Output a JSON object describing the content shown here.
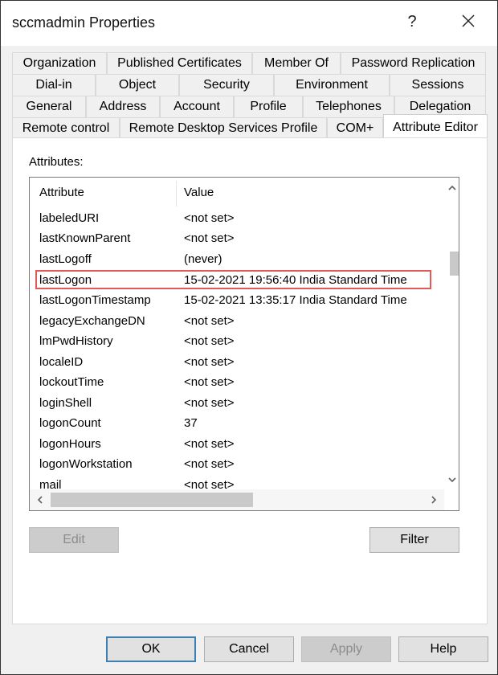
{
  "window": {
    "title": "sccmadmin Properties",
    "help_label": "?"
  },
  "tabs": {
    "row1": [
      "Organization",
      "Published Certificates",
      "Member Of",
      "Password Replication"
    ],
    "row2": [
      "Dial-in",
      "Object",
      "Security",
      "Environment",
      "Sessions"
    ],
    "row3": [
      "General",
      "Address",
      "Account",
      "Profile",
      "Telephones",
      "Delegation"
    ],
    "row4": [
      "Remote control",
      "Remote Desktop Services Profile",
      "COM+",
      "Attribute Editor"
    ],
    "active": "Attribute Editor"
  },
  "attributes": {
    "label": "Attributes:",
    "columns": {
      "attribute": "Attribute",
      "value": "Value"
    },
    "rows": [
      {
        "attribute": "labeledURI",
        "value": "<not set>"
      },
      {
        "attribute": "lastKnownParent",
        "value": "<not set>"
      },
      {
        "attribute": "lastLogoff",
        "value": "(never)"
      },
      {
        "attribute": "lastLogon",
        "value": "15-02-2021 19:56:40 India Standard Time"
      },
      {
        "attribute": "lastLogonTimestamp",
        "value": "15-02-2021 13:35:17 India Standard Time"
      },
      {
        "attribute": "legacyExchangeDN",
        "value": "<not set>"
      },
      {
        "attribute": "lmPwdHistory",
        "value": "<not set>"
      },
      {
        "attribute": "localeID",
        "value": "<not set>"
      },
      {
        "attribute": "lockoutTime",
        "value": "<not set>"
      },
      {
        "attribute": "loginShell",
        "value": "<not set>"
      },
      {
        "attribute": "logonCount",
        "value": "37"
      },
      {
        "attribute": "logonHours",
        "value": "<not set>"
      },
      {
        "attribute": "logonWorkstation",
        "value": "<not set>"
      },
      {
        "attribute": "mail",
        "value": "<not set>"
      }
    ],
    "highlighted_row": "lastLogon"
  },
  "panel_buttons": {
    "edit": "Edit",
    "filter": "Filter"
  },
  "footer_buttons": {
    "ok": "OK",
    "cancel": "Cancel",
    "apply": "Apply",
    "help": "Help"
  },
  "colors": {
    "highlight_border": "#e05a5a",
    "default_button_border": "#3c7fb1"
  },
  "icons": [
    "close-icon",
    "scroll-up-icon",
    "scroll-down-icon",
    "scroll-left-icon",
    "scroll-right-icon"
  ]
}
